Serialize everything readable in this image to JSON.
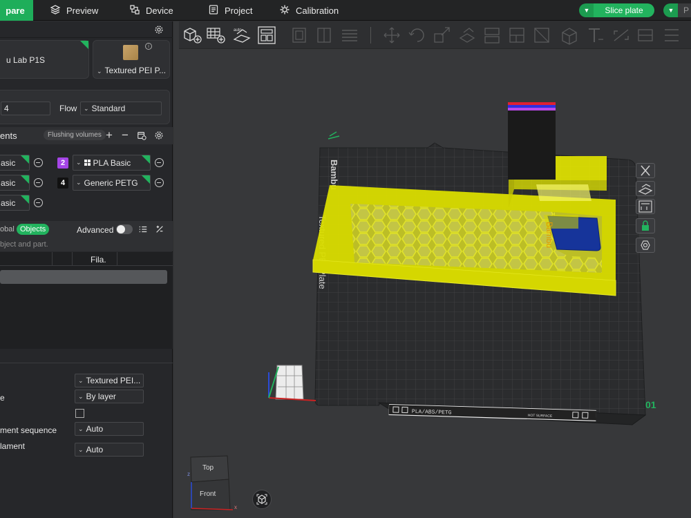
{
  "topbar": {
    "tabs": [
      {
        "label": "pare",
        "icon": "prepare-icon",
        "active": true
      },
      {
        "label": "Preview",
        "icon": "layers-icon"
      },
      {
        "label": "Device",
        "icon": "device-icon"
      },
      {
        "label": "Project",
        "icon": "project-icon"
      },
      {
        "label": "Calibration",
        "icon": "calibration-icon"
      }
    ],
    "slice_label": "Slice plate",
    "print_label": "P",
    "accent": "#22b35e"
  },
  "printer": {
    "printer_name": "u Lab P1S",
    "plate_name": "Textured PEI P...",
    "nozzle_value": "4",
    "flow_label": "Flow",
    "flow_value": "Standard"
  },
  "filaments": {
    "title": "ents",
    "flushing_label": "Flushing volumes",
    "items": [
      {
        "name": "asic"
      },
      {
        "name": "asic"
      },
      {
        "name": "asic"
      },
      {
        "num": "2",
        "name": "PLA Basic",
        "color": "#a545e6"
      },
      {
        "num": "4",
        "name": "Generic PETG",
        "color": "#111111"
      }
    ]
  },
  "objects": {
    "global_label": "obal",
    "objects_label": "Objects",
    "advanced_label": "Advanced",
    "hint": "bject and part.",
    "col_fila": "Fila."
  },
  "plate_settings": {
    "rows": [
      {
        "label": "",
        "value": "Textured PEI..."
      },
      {
        "label": "e",
        "value": "By layer"
      },
      {
        "label": "",
        "value": ""
      },
      {
        "label": "ment sequence",
        "value": "Auto"
      },
      {
        "label": "lament",
        "value": "Auto"
      }
    ]
  },
  "scene": {
    "bed_brand": "Bambu",
    "bed_type": "Textured PEI Plate",
    "bed_label_strip": "PLA/ABS/PETG",
    "hot_surface": "HOT SURFACE",
    "plate_number": "01",
    "part_label": "Bambu"
  },
  "navcube": {
    "top": "Top",
    "front": "Front",
    "axis_x": "x",
    "axis_z": "z"
  }
}
